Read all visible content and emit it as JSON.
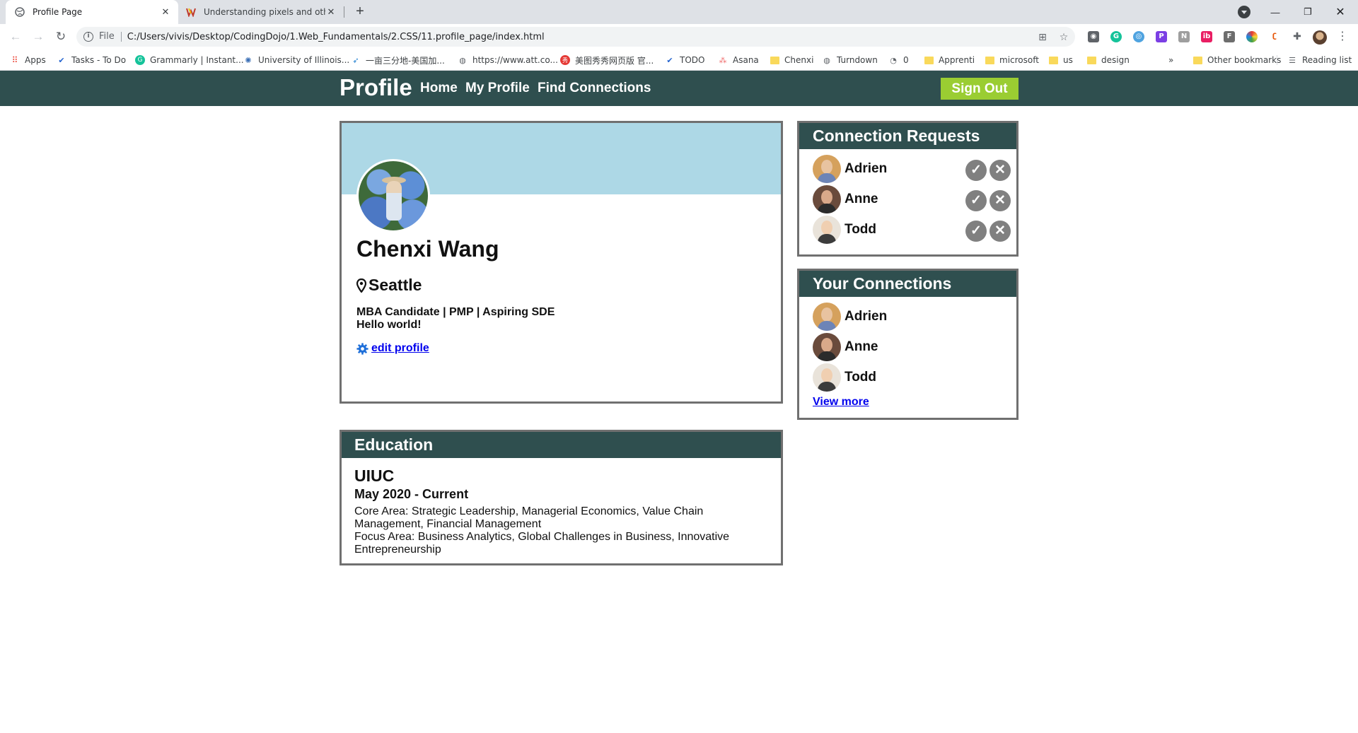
{
  "browser": {
    "tabs": [
      {
        "title": "Profile Page",
        "active": true
      },
      {
        "title": "Understanding pixels and other C",
        "active": false
      }
    ],
    "address": {
      "scheme": "File",
      "url": "C:/Users/vivis/Desktop/CodingDojo/1.Web_Fundamentals/2.CSS/11.profile_page/index.html"
    },
    "bookmarks": [
      "Apps",
      "Tasks - To Do",
      "Grammarly | Instant...",
      "University of Illinois...",
      "一亩三分地-美国加...",
      "https://www.att.co...",
      "美图秀秀网页版 官...",
      "TODO",
      "Asana",
      "Chenxi",
      "Turndown",
      "0",
      "Apprenti",
      "microsoft",
      "us",
      "design"
    ],
    "bookmarks_overflow": "»",
    "other_bookmarks": "Other bookmarks",
    "reading_list": "Reading list"
  },
  "header": {
    "brand": "Profile",
    "nav": [
      "Home",
      "My Profile",
      "Find Connections"
    ],
    "signout": "Sign Out"
  },
  "profile": {
    "name": "Chenxi Wang",
    "location": "Seattle",
    "headline": "MBA Candidate | PMP | Aspiring SDE",
    "bio": "Hello world!",
    "edit_label": "edit profile"
  },
  "education": {
    "heading": "Education",
    "school": "UIUC",
    "dates": "May 2020 - Current",
    "core": "Core Area: Strategic Leadership, Managerial Economics, Value Chain Management, Financial Management",
    "focus": "Focus Area: Business Analytics, Global Challenges in Business, Innovative Entrepreneurship"
  },
  "requests": {
    "heading": "Connection Requests",
    "people": [
      "Adrien",
      "Anne",
      "Todd"
    ],
    "accept_icon": "check-icon",
    "decline_icon": "close-icon"
  },
  "connections": {
    "heading": "Your Connections",
    "people": [
      "Adrien",
      "Anne",
      "Todd"
    ],
    "view_more": "View more"
  },
  "colors": {
    "header_bg": "#2f4f4f",
    "banner_bg": "#add8e6",
    "signout_bg": "#9acd32",
    "card_border": "#707070"
  }
}
